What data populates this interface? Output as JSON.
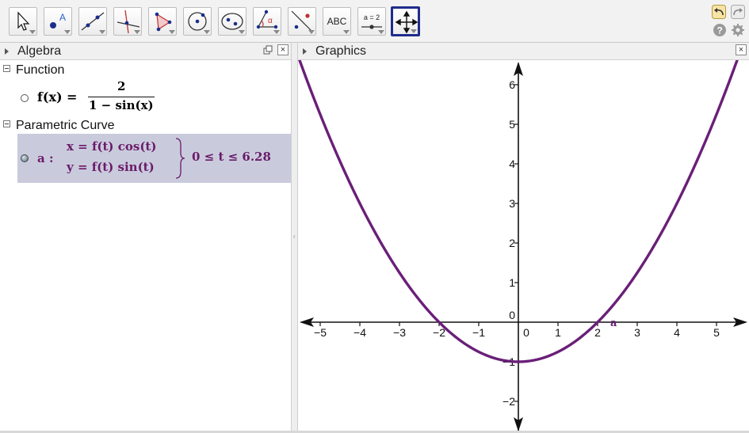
{
  "toolbar": {
    "tools": [
      {
        "name": "move",
        "label": ""
      },
      {
        "name": "point",
        "label": ""
      },
      {
        "name": "line",
        "label": ""
      },
      {
        "name": "perpendicular",
        "label": ""
      },
      {
        "name": "polygon",
        "label": ""
      },
      {
        "name": "circle",
        "label": ""
      },
      {
        "name": "conic",
        "label": ""
      },
      {
        "name": "angle",
        "label": ""
      },
      {
        "name": "reflect",
        "label": ""
      },
      {
        "name": "text",
        "label": "ABC"
      },
      {
        "name": "slider",
        "label": "a = 2"
      },
      {
        "name": "move-graphics",
        "label": ""
      }
    ]
  },
  "algebra": {
    "title": "Algebra",
    "categories": {
      "function": "Function",
      "parametric": "Parametric Curve"
    },
    "function": {
      "lhs": "f(x)",
      "eq": "=",
      "num": "2",
      "den": "1 − sin(x)"
    },
    "curve": {
      "name": "a :",
      "x_eq": "x = f(t)  cos(t)",
      "y_eq": "y = f(t)  sin(t)",
      "range": "0 ≤ t ≤ 6.28",
      "color": "#6a1a6a"
    }
  },
  "graphics": {
    "title": "Graphics",
    "curve_label": "a",
    "x_ticks": [
      "-5",
      "-4",
      "-3",
      "-2",
      "-1",
      "0",
      "1",
      "2",
      "3",
      "4",
      "5"
    ],
    "y_ticks": [
      "6",
      "5",
      "4",
      "3",
      "2",
      "1",
      "0",
      "-1",
      "-2"
    ],
    "colors": {
      "curve": "#6a1f78",
      "axis": "#111111"
    }
  }
}
